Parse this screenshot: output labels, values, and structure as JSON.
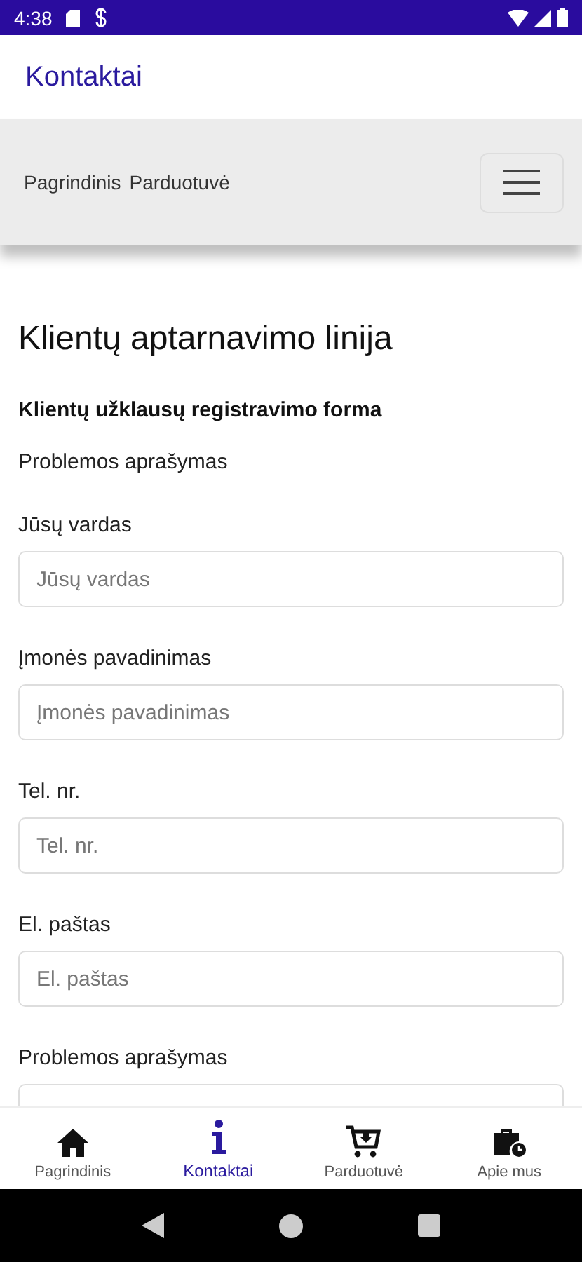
{
  "status_bar": {
    "time": "4:38"
  },
  "app_bar": {
    "title": "Kontaktai"
  },
  "site_nav": {
    "links": [
      "Pagrindinis",
      "Parduotuvė"
    ]
  },
  "heading": "Klientų aptarnavimo linija",
  "form": {
    "title": "Klientų užklausų registravimo forma",
    "section": "Problemos aprašymas",
    "fields": [
      {
        "label": "Jūsų vardas",
        "placeholder": "Jūsų vardas"
      },
      {
        "label": "Įmonės pavadinimas",
        "placeholder": "Įmonės pavadinimas"
      },
      {
        "label": "Tel. nr.",
        "placeholder": "Tel. nr."
      },
      {
        "label": "El. paštas",
        "placeholder": "El. paštas"
      },
      {
        "label": "Problemos aprašymas"
      }
    ]
  },
  "bottom_nav": [
    {
      "kind": "home",
      "label": "Pagrindinis",
      "selected": false
    },
    {
      "kind": "info",
      "label": "Kontaktai",
      "selected": true
    },
    {
      "kind": "cart",
      "label": "Parduotuvė",
      "selected": false
    },
    {
      "kind": "about",
      "label": "Apie mus",
      "selected": false
    }
  ]
}
